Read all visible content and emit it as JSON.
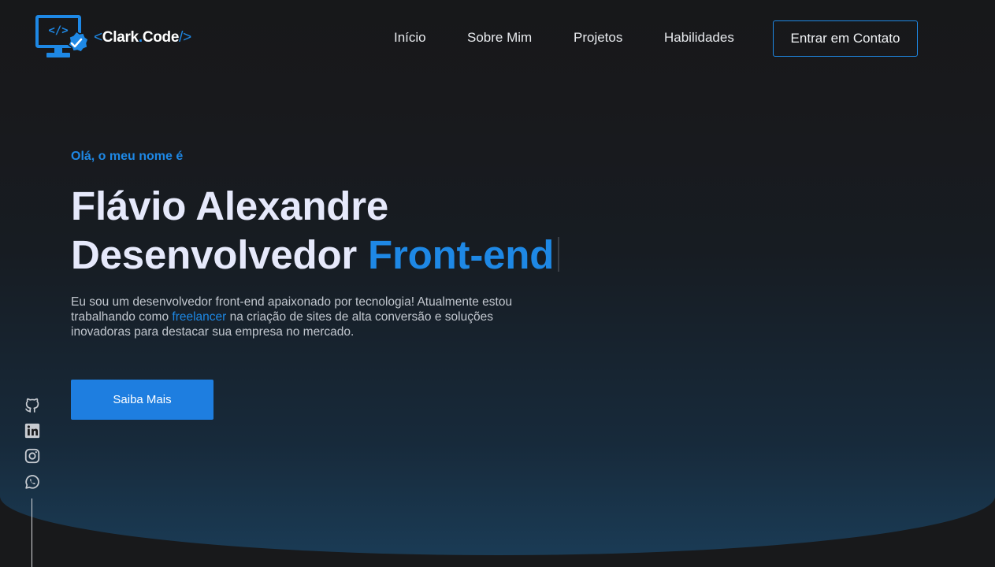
{
  "header": {
    "logo": {
      "prefix": "<",
      "name_part1": "Clark",
      "dot": ".",
      "name_part2": "Code",
      "suffix": "/>",
      "icon": "monitor-code-icon"
    },
    "nav": [
      {
        "label": "Início"
      },
      {
        "label": "Sobre Mim"
      },
      {
        "label": "Projetos"
      },
      {
        "label": "Habilidades"
      }
    ],
    "cta_label": "Entrar em Contato"
  },
  "hero": {
    "greeting": "Olá, o meu nome é",
    "name": "Flávio Alexandre",
    "role_prefix": "Desenvolvedor",
    "role_highlight": "Front-end",
    "bio_part1": "Eu sou um desenvolvedor front-end apaixonado por tecnologia! Atualmente estou trabalhando como ",
    "bio_link": "freelancer",
    "bio_part2": " na criação de sites de alta conversão e soluções inovadoras para destacar sua empresa no mercado.",
    "button_label": "Saiba Mais"
  },
  "social": [
    {
      "icon": "github-icon"
    },
    {
      "icon": "linkedin-icon"
    },
    {
      "icon": "instagram-icon"
    },
    {
      "icon": "whatsapp-icon"
    }
  ],
  "colors": {
    "accent": "#1e88e5",
    "background": "#18191b",
    "heading": "#e6e9fb",
    "body_text": "#c2c7cf"
  }
}
